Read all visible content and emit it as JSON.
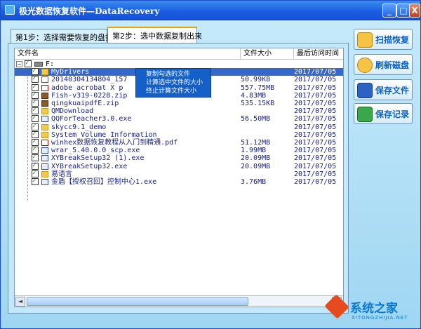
{
  "window": {
    "title": "极光数据恢复软件—DataRecovery",
    "min_label": "_",
    "max_label": "□",
    "close_label": "X"
  },
  "tabs": [
    {
      "label": "第1步：选择需要恢复的盘扫描"
    },
    {
      "label": "第2步：选中数据复制出来"
    }
  ],
  "columns": {
    "name": "文件名",
    "size": "文件大小",
    "date": "最后访问时间"
  },
  "root": {
    "label": "F:"
  },
  "files": [
    {
      "name": "MyDrivers",
      "size": "",
      "date": "2017/07/05",
      "type": "folder",
      "selected": true
    },
    {
      "name": "20140304134804_157",
      "size": "50.99KB",
      "date": "2017/07/05",
      "type": "file",
      "selected": false
    },
    {
      "name": "adobe acrobat X p",
      "size": "557.75MB",
      "date": "2017/07/05",
      "type": "pdf",
      "selected": false
    },
    {
      "name": "Fish-v319-0228.zip",
      "size": "4.83MB",
      "date": "2017/07/05",
      "type": "zip",
      "selected": false
    },
    {
      "name": "qingkuaipdfE.zip",
      "size": "535.15KB",
      "date": "2017/07/05",
      "type": "zip",
      "selected": false
    },
    {
      "name": "QMDownload",
      "size": "",
      "date": "2017/07/05",
      "type": "folder",
      "selected": false
    },
    {
      "name": "QQForTeacher3.0.exe",
      "size": "56.50MB",
      "date": "2017/07/05",
      "type": "exe",
      "selected": false
    },
    {
      "name": "skycc9.1_demo",
      "size": "",
      "date": "2017/07/05",
      "type": "folder",
      "selected": false
    },
    {
      "name": "System Volume Information",
      "size": "",
      "date": "2017/07/05",
      "type": "folder",
      "selected": false
    },
    {
      "name": "winhex数据恢复教程从入门到精通.pdf",
      "size": "51.12MB",
      "date": "2017/07/05",
      "type": "pdf",
      "selected": false
    },
    {
      "name": "wrar_5.40.0.0_scp.exe",
      "size": "1.99MB",
      "date": "2017/07/05",
      "type": "exe",
      "selected": false
    },
    {
      "name": "XYBreakSetup32 (1).exe",
      "size": "20.09MB",
      "date": "2017/07/05",
      "type": "exe",
      "selected": false
    },
    {
      "name": "XYBreakSetup32.exe",
      "size": "20.09MB",
      "date": "2017/07/05",
      "type": "exe",
      "selected": false
    },
    {
      "name": "易语言",
      "size": "",
      "date": "2017/07/05",
      "type": "folder",
      "selected": false
    },
    {
      "name": "金盾【授权召回】控制中心1.exe",
      "size": "3.76MB",
      "date": "2017/07/05",
      "type": "exe",
      "selected": false
    }
  ],
  "context_menu": [
    {
      "label": "复制勾选的文件"
    },
    {
      "label": "计算选中文件的大小"
    },
    {
      "label": "终止计算文件大小"
    }
  ],
  "side_buttons": {
    "scan": "扫描恢复",
    "refresh": "刷新磁盘",
    "save_file": "保存文件",
    "save_record": "保存记录"
  },
  "scroll": {
    "left": "◄",
    "right": "►"
  },
  "watermark": {
    "main": "系统之家",
    "sub": "XITONGZHIJIA.NET"
  }
}
